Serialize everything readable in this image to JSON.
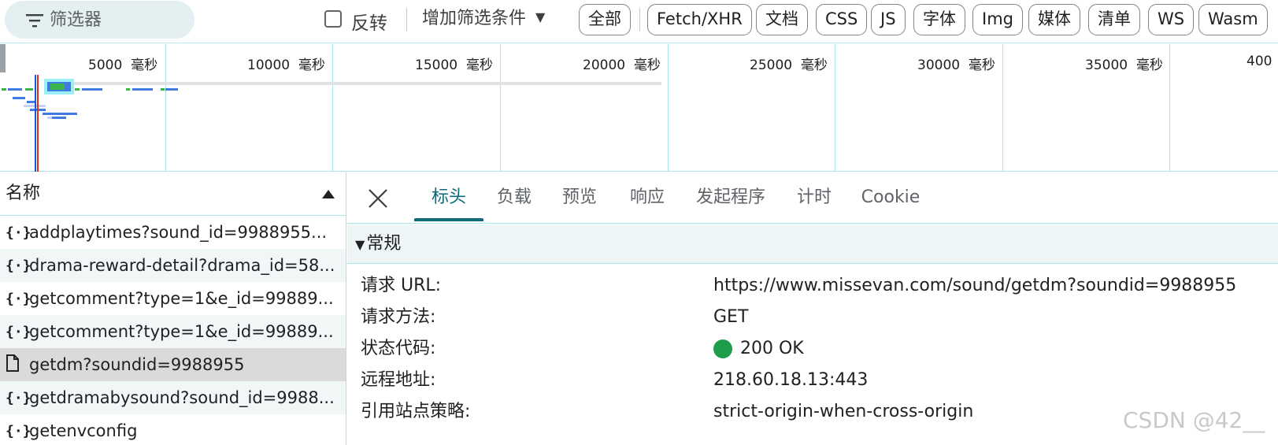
{
  "toolbar": {
    "filter_placeholder": "筛选器",
    "invert_label": "反转",
    "add_filter_label": "增加筛选条件",
    "types": [
      {
        "label": "全部",
        "active": false
      },
      {
        "label": "Fetch/XHR",
        "active": true
      },
      {
        "label": "文档",
        "active": false
      },
      {
        "label": "CSS",
        "active": false
      },
      {
        "label": "JS",
        "active": false
      },
      {
        "label": "字体",
        "active": false
      },
      {
        "label": "Img",
        "active": false
      },
      {
        "label": "媒体",
        "active": false
      },
      {
        "label": "清单",
        "active": false
      },
      {
        "label": "WS",
        "active": false
      },
      {
        "label": "Wasm",
        "active": false
      }
    ]
  },
  "overview": {
    "ticks": [
      {
        "value": "5000",
        "unit": "毫秒"
      },
      {
        "value": "10000",
        "unit": "毫秒"
      },
      {
        "value": "15000",
        "unit": "毫秒"
      },
      {
        "value": "20000",
        "unit": "毫秒"
      },
      {
        "value": "25000",
        "unit": "毫秒"
      },
      {
        "value": "30000",
        "unit": "毫秒"
      },
      {
        "value": "35000",
        "unit": "毫秒"
      },
      {
        "value": "400",
        "unit": ""
      }
    ]
  },
  "request_list": {
    "header": "名称",
    "rows": [
      {
        "icon": "fetch-icon",
        "name": "addplaytimes?sound_id=9988955..."
      },
      {
        "icon": "fetch-icon",
        "name": "drama-reward-detail?drama_id=58..."
      },
      {
        "icon": "fetch-icon",
        "name": "getcomment?type=1&e_id=99889..."
      },
      {
        "icon": "fetch-icon",
        "name": "getcomment?type=1&e_id=99889..."
      },
      {
        "icon": "document-icon",
        "name": "getdm?soundid=9988955",
        "selected": true
      },
      {
        "icon": "fetch-icon",
        "name": "getdramabysound?sound_id=9988..."
      },
      {
        "icon": "fetch-icon",
        "name": "getenvconfig"
      }
    ]
  },
  "details": {
    "tabs": [
      "标头",
      "负载",
      "预览",
      "响应",
      "发起程序",
      "计时",
      "Cookie"
    ],
    "active_tab": "标头",
    "section_title": "常规",
    "rows": [
      {
        "key": "请求 URL:",
        "value": "https://www.missevan.com/sound/getdm?soundid=9988955"
      },
      {
        "key": "请求方法:",
        "value": "GET"
      },
      {
        "key": "状态代码:",
        "value": "200 OK",
        "status_color": "#1e9e4a"
      },
      {
        "key": "远程地址:",
        "value": "218.60.18.13:443"
      },
      {
        "key": "引用站点策略:",
        "value": "strict-origin-when-cross-origin"
      }
    ]
  },
  "watermark": "CSDN @42__",
  "colors": {
    "accent": "#0b6b7a",
    "divider": "#a6e6ea",
    "status_ok": "#1e9e4a",
    "waterfall_blue": "#3f7be0",
    "waterfall_green": "#3bb54a"
  }
}
